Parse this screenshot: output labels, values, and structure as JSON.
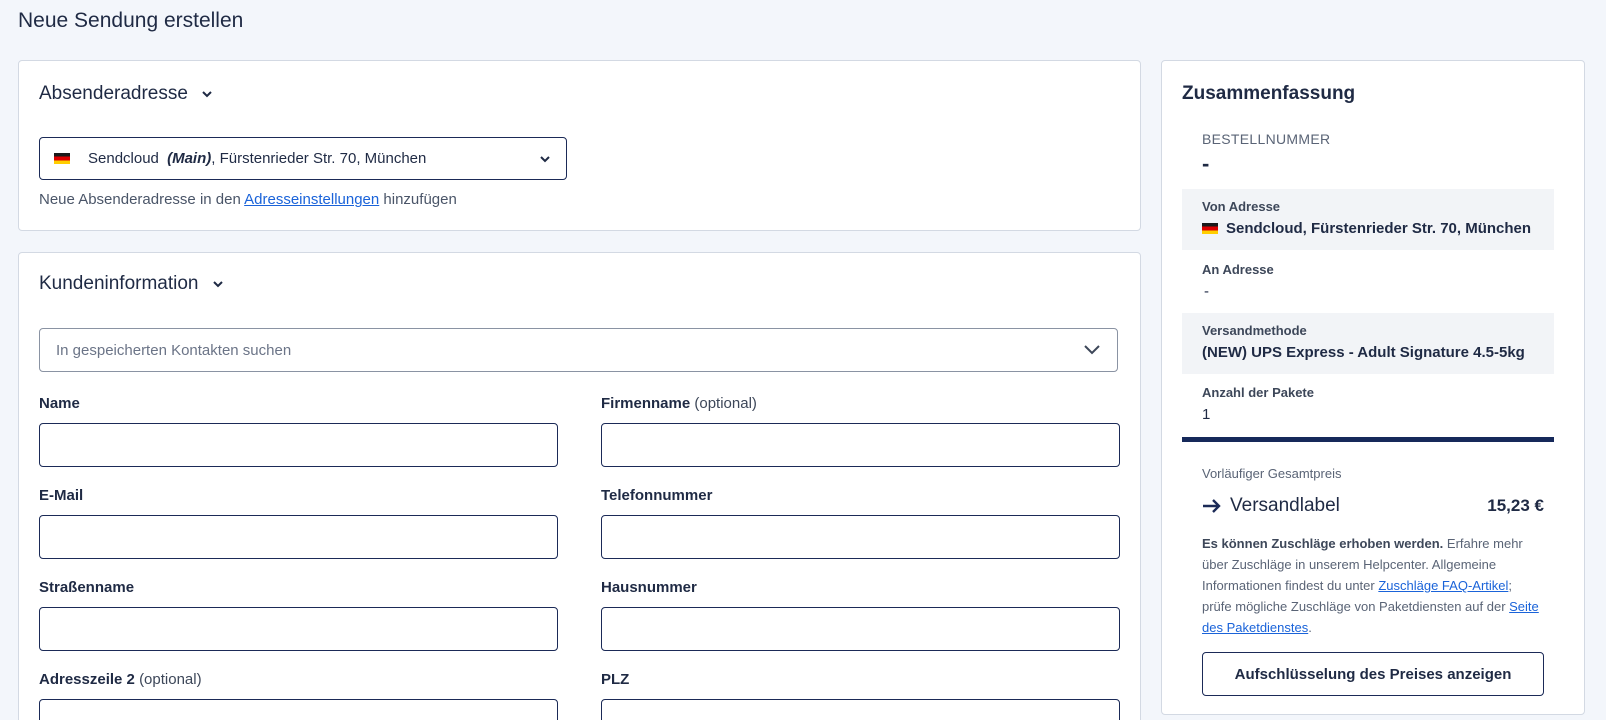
{
  "page": {
    "title": "Neue Sendung erstellen"
  },
  "sender": {
    "heading": "Absenderadresse",
    "select": {
      "name": "Sendcloud",
      "tag": "(Main)",
      "address": ", Fürstenrieder Str. 70, München"
    },
    "hint_prefix": "Neue Absenderadresse in den ",
    "hint_link": "Adresseinstellungen",
    "hint_suffix": " hinzufügen"
  },
  "customer": {
    "heading": "Kundeninformation",
    "search_placeholder": "In gespeicherten Kontakten suchen",
    "fields": {
      "name": {
        "label": "Name",
        "optional": ""
      },
      "company": {
        "label": "Firmenname",
        "optional": "(optional)"
      },
      "email": {
        "label": "E-Mail",
        "optional": ""
      },
      "phone": {
        "label": "Telefonnummer",
        "optional": ""
      },
      "street": {
        "label": "Straßenname",
        "optional": ""
      },
      "house": {
        "label": "Hausnummer",
        "optional": ""
      },
      "address2": {
        "label": "Adresszeile 2",
        "optional": "(optional)"
      },
      "zip": {
        "label": "PLZ",
        "optional": ""
      }
    }
  },
  "summary": {
    "heading": "Zusammenfassung",
    "order_number_label": "BESTELLNUMMER",
    "order_number_value": "-",
    "from_label": "Von Adresse",
    "from_value": "Sendcloud, Fürstenrieder Str. 70, München",
    "to_label": "An Adresse",
    "to_value": "-",
    "method_label": "Versandmethode",
    "method_value": "(NEW) UPS Express - Adult Signature 4.5-5kg",
    "packages_label": "Anzahl der Pakete",
    "packages_value": "1",
    "total_label": "Vorläufiger Gesamtpreis",
    "label_name": "Versandlabel",
    "label_price": "15,23 €",
    "note_bold": "Es können Zuschläge erhoben werden.",
    "note_text1": " Erfahre mehr über Zuschläge in unserem Helpcenter. Allgemeine Informationen findest du unter ",
    "note_link1": "Zuschläge FAQ-Artikel",
    "note_text2": "; prüfe mögliche Zuschläge von Paketdiensten auf der ",
    "note_link2": "Seite des Paketdienstes",
    "note_text3": ".",
    "button_label": "Aufschlüsselung des Preises anzeigen"
  },
  "colors": {
    "navy": "#1b2a57",
    "link": "#1a63d9",
    "divider": "#16295a"
  }
}
